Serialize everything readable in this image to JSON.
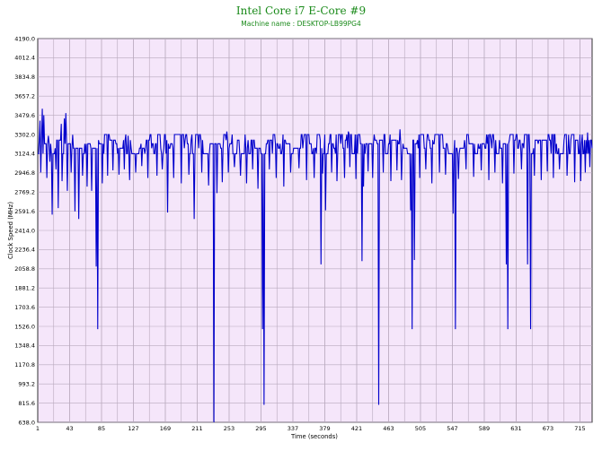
{
  "chart_data": {
    "type": "line",
    "title": "Intel Core i7 E-Core #9",
    "subtitle": "Machine name : DESKTOP-LB99PG4",
    "xlabel": "Time (seconds)",
    "ylabel": "Clock Speed (MHz)",
    "xlim": [
      1,
      731
    ],
    "ylim": [
      638.0,
      4190.0
    ],
    "grid": true,
    "legend": "none",
    "colors": {
      "line": "#0000cc",
      "plot_bg": "#f5e6fa",
      "grid": "#b8a9bd",
      "title": "#1a8a1a"
    },
    "x_ticks": [
      "1",
      "43",
      "85",
      "127",
      "169",
      "211",
      "253",
      "295",
      "337",
      "379",
      "421",
      "463",
      "505",
      "547",
      "589",
      "631",
      "673",
      "715"
    ],
    "y_ticks": [
      "638.0",
      "815.6",
      "993.2",
      "1170.8",
      "1348.4",
      "1526.0",
      "1703.6",
      "1881.2",
      "2058.8",
      "2236.4",
      "2414.0",
      "2591.6",
      "2769.2",
      "2946.8",
      "3124.4",
      "3302.0",
      "3479.6",
      "3657.2",
      "3834.8",
      "4012.4",
      "4190.0"
    ],
    "series": [
      {
        "baseline": 3216,
        "dips": [
          [
            5,
            2950
          ],
          [
            9,
            3480
          ],
          [
            13,
            2900
          ],
          [
            17,
            3050
          ],
          [
            20,
            2560
          ],
          [
            25,
            2980
          ],
          [
            28,
            2620
          ],
          [
            33,
            2870
          ],
          [
            36,
            3450
          ],
          [
            40,
            2780
          ],
          [
            45,
            2950
          ],
          [
            50,
            2590
          ],
          [
            55,
            2520
          ],
          [
            60,
            2920
          ],
          [
            66,
            2820
          ],
          [
            72,
            2780
          ],
          [
            78,
            2080
          ],
          [
            80,
            1500
          ],
          [
            86,
            2850
          ],
          [
            93,
            2920
          ],
          [
            100,
            2970
          ],
          [
            108,
            2930
          ],
          [
            115,
            2980
          ],
          [
            122,
            2880
          ],
          [
            130,
            2950
          ],
          [
            138,
            3010
          ],
          [
            146,
            2900
          ],
          [
            158,
            2920
          ],
          [
            165,
            2980
          ],
          [
            172,
            2580
          ],
          [
            180,
            2900
          ],
          [
            190,
            2850
          ],
          [
            200,
            2930
          ],
          [
            207,
            2520
          ],
          [
            217,
            2950
          ],
          [
            226,
            2830
          ],
          [
            233,
            638
          ],
          [
            237,
            2760
          ],
          [
            244,
            2860
          ],
          [
            252,
            2950
          ],
          [
            260,
            3000
          ],
          [
            268,
            2920
          ],
          [
            276,
            2850
          ],
          [
            284,
            2980
          ],
          [
            291,
            2800
          ],
          [
            297,
            1500
          ],
          [
            299,
            800
          ],
          [
            306,
            2980
          ],
          [
            315,
            2900
          ],
          [
            325,
            2820
          ],
          [
            334,
            2950
          ],
          [
            345,
            2990
          ],
          [
            355,
            2880
          ],
          [
            365,
            2900
          ],
          [
            374,
            2100
          ],
          [
            376,
            2940
          ],
          [
            380,
            2600
          ],
          [
            388,
            2950
          ],
          [
            395,
            2870
          ],
          [
            405,
            2900
          ],
          [
            412,
            3000
          ],
          [
            420,
            2890
          ],
          [
            428,
            2130
          ],
          [
            430,
            2820
          ],
          [
            436,
            2960
          ],
          [
            442,
            2900
          ],
          [
            450,
            800
          ],
          [
            456,
            2950
          ],
          [
            466,
            2870
          ],
          [
            474,
            2970
          ],
          [
            480,
            2880
          ],
          [
            492,
            2600
          ],
          [
            494,
            1500
          ],
          [
            497,
            2140
          ],
          [
            504,
            2900
          ],
          [
            512,
            2980
          ],
          [
            520,
            2850
          ],
          [
            530,
            2950
          ],
          [
            538,
            2930
          ],
          [
            548,
            2570
          ],
          [
            551,
            1500
          ],
          [
            555,
            2890
          ],
          [
            565,
            2980
          ],
          [
            575,
            2910
          ],
          [
            585,
            2970
          ],
          [
            595,
            2880
          ],
          [
            603,
            2950
          ],
          [
            613,
            2850
          ],
          [
            618,
            2100
          ],
          [
            620,
            1500
          ],
          [
            628,
            2940
          ],
          [
            638,
            2980
          ],
          [
            646,
            2100
          ],
          [
            650,
            1500
          ],
          [
            655,
            2920
          ],
          [
            664,
            2880
          ],
          [
            672,
            2960
          ],
          [
            680,
            2900
          ],
          [
            688,
            2980
          ],
          [
            698,
            2920
          ],
          [
            708,
            2860
          ],
          [
            716,
            2870
          ],
          [
            722,
            2950
          ],
          [
            728,
            3000
          ]
        ],
        "peaks": [
          [
            4,
            3430
          ],
          [
            7,
            3540
          ],
          [
            15,
            3290
          ],
          [
            32,
            3400
          ],
          [
            38,
            3500
          ],
          [
            47,
            3300
          ],
          [
            120,
            3290
          ],
          [
            250,
            3330
          ],
          [
            410,
            3330
          ],
          [
            478,
            3350
          ],
          [
            620,
            3320
          ],
          [
            700,
            3300
          ],
          [
            725,
            3320
          ]
        ]
      }
    ]
  }
}
